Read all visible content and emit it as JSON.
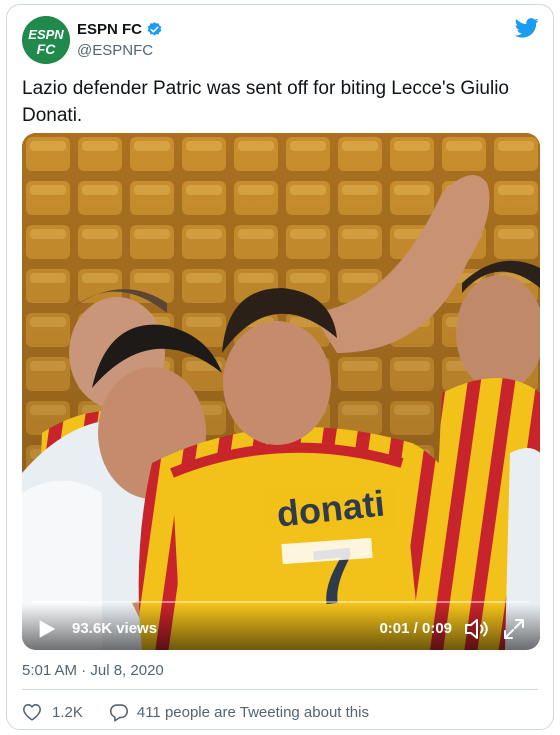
{
  "author": {
    "name": "ESPN FC",
    "handle": "@ESPNFC",
    "logo_text_top": "ESPN",
    "logo_text_bottom": "FC",
    "verified": true
  },
  "tweet": {
    "text": "Lazio defender Patric was sent off for biting Lecce's Giulio Donati."
  },
  "video": {
    "views": "93.6K views",
    "time": "0:01 / 0:09",
    "progress": 0.11,
    "shirt_name": "donati",
    "shirt_number": "7",
    "icons": [
      "play-icon",
      "volume-icon",
      "fullscreen-icon"
    ]
  },
  "timestamp": "5:01 AM · Jul 8, 2020",
  "footer": {
    "like_count": "1.2K",
    "reply_text": "411 people are Tweeting about this"
  },
  "colors": {
    "twitter_blue": "#1d9bf0",
    "espn_green": "#1f8a4c",
    "lecce_yellow": "#f2c21a",
    "lecce_red": "#c8242b",
    "muted_text": "#536471"
  }
}
